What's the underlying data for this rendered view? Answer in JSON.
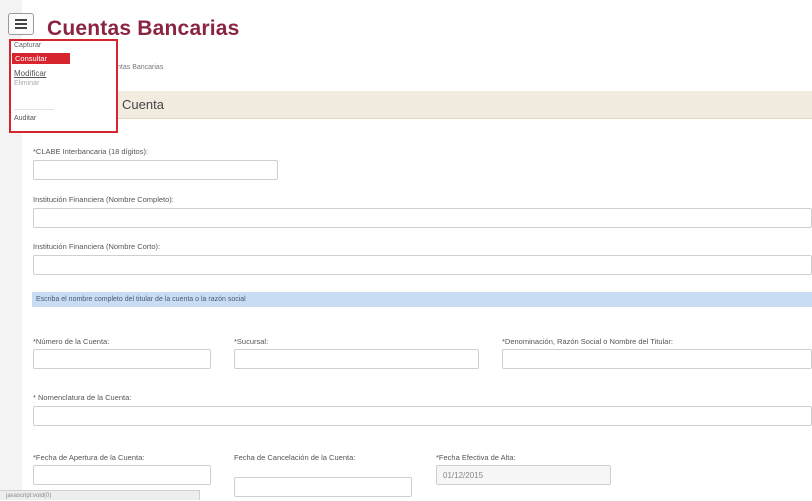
{
  "header": {
    "title": "Cuentas Bancarias"
  },
  "breadcrumb": "Bancos / Cuentas Bancarias",
  "section": {
    "title": "Cuenta"
  },
  "menu": {
    "caption": "Capturar",
    "items": [
      {
        "label": "Consultar",
        "selected": true
      },
      {
        "label": "Modificar"
      },
      {
        "label": "Eliminar"
      },
      {
        "label": "Auditar"
      }
    ]
  },
  "form": {
    "clabe": {
      "label": "*CLABE Interbancaria (18 dígitos):",
      "value": ""
    },
    "institucion_completo": {
      "label": "Institución Financiera (Nombre Completo):",
      "value": ""
    },
    "institucion_corto": {
      "label": "Institución Financiera (Nombre Corto):",
      "value": ""
    },
    "banner": "Escriba el nombre completo del titular de la cuenta o la razón social",
    "numero_cuenta": {
      "label": "*Número de la Cuenta:",
      "value": ""
    },
    "sucursal": {
      "label": "*Sucursal:",
      "value": ""
    },
    "denominacion": {
      "label": "*Denominación, Razón Social o Nombre del Titular:",
      "value": ""
    },
    "nomenclatura": {
      "label": "* Nomenclatura de la Cuenta:",
      "value": ""
    },
    "fecha_apertura": {
      "label": "*Fecha de Apertura de la Cuenta:",
      "value": ""
    },
    "fecha_cancelacion": {
      "label": "Fecha de Cancelación de la Cuenta:",
      "value": ""
    },
    "fecha_alta": {
      "label": "*Fecha Efectiva de Alta:",
      "value": "01/12/2015"
    }
  },
  "status_bar": "javascript:void(0)"
}
